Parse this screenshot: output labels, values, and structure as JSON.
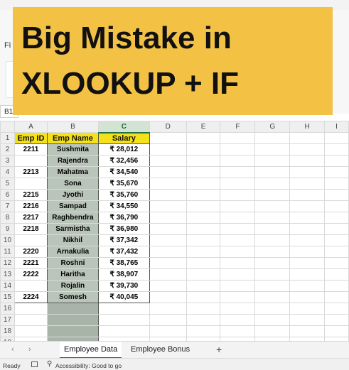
{
  "window": {
    "ribbon_tab_partial": "Fi",
    "name_box": "B1"
  },
  "banner": {
    "line1": "Big Mistake in",
    "line2": "XLOOKUP + IF"
  },
  "grid": {
    "columns": [
      "A",
      "B",
      "C",
      "D",
      "E",
      "F",
      "G",
      "H",
      "I"
    ],
    "selected_column": "C",
    "headers": [
      "Emp ID",
      "Emp Name",
      "Salary"
    ],
    "rows": [
      {
        "n": "2",
        "id": "2211",
        "name": "Sushmita",
        "salary": "₹ 28,012"
      },
      {
        "n": "3",
        "id": "",
        "name": "Rajendra",
        "salary": "₹ 32,456"
      },
      {
        "n": "4",
        "id": "2213",
        "name": "Mahatma",
        "salary": "₹ 34,540"
      },
      {
        "n": "5",
        "id": "",
        "name": "Sona",
        "salary": "₹ 35,670"
      },
      {
        "n": "6",
        "id": "2215",
        "name": "Jyothi",
        "salary": "₹ 35,760"
      },
      {
        "n": "7",
        "id": "2216",
        "name": "Sampad",
        "salary": "₹ 34,550"
      },
      {
        "n": "8",
        "id": "2217",
        "name": "Raghbendra",
        "salary": "₹ 36,790"
      },
      {
        "n": "9",
        "id": "2218",
        "name": "Sarmistha",
        "salary": "₹ 36,980"
      },
      {
        "n": "10",
        "id": "",
        "name": "Nikhil",
        "salary": "₹ 37,342"
      },
      {
        "n": "11",
        "id": "2220",
        "name": "Arnakulia",
        "salary": "₹ 37,432"
      },
      {
        "n": "12",
        "id": "2221",
        "name": "Roshni",
        "salary": "₹ 38,765"
      },
      {
        "n": "13",
        "id": "2222",
        "name": "Haritha",
        "salary": "₹ 38,907"
      },
      {
        "n": "14",
        "id": "",
        "name": "Rojalin",
        "salary": "₹ 39,730"
      },
      {
        "n": "15",
        "id": "2224",
        "name": "Somesh",
        "salary": "₹ 40,045"
      }
    ],
    "empty_rows": [
      "16",
      "17",
      "18",
      "19",
      "20"
    ]
  },
  "sheet_tabs": {
    "tabs": [
      "Employee Data",
      "Employee Bonus"
    ],
    "add": "+",
    "prev_icon": "‹",
    "next_icon": "›"
  },
  "status": {
    "ready": "Ready",
    "accessibility": "Accessibility: Good to go"
  },
  "colors": {
    "banner": "#f3c245",
    "header_fill": "#f5e11a",
    "selected_column_fill": "#b9c5b9",
    "excel_green": "#217346"
  }
}
